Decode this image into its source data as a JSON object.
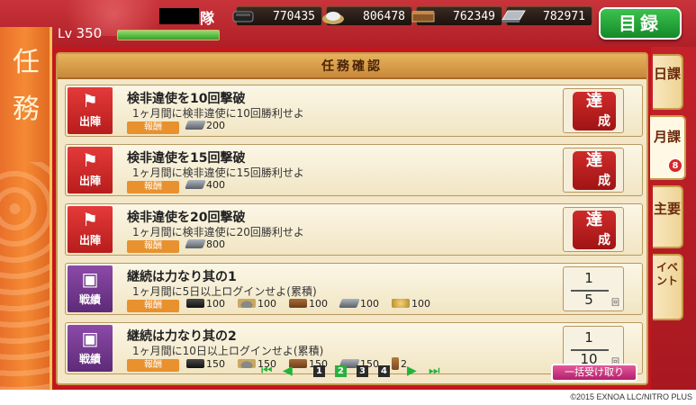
{
  "header": {
    "level_label": "Lv",
    "level_value": "350",
    "hp_fraction": 1.0,
    "unit_suffix": "隊",
    "resources": [
      {
        "icon": "charcoal-icon",
        "value": "770435"
      },
      {
        "icon": "coolant-icon",
        "value": "806478"
      },
      {
        "icon": "whetstone-icon",
        "value": "762349"
      },
      {
        "icon": "steel-icon",
        "value": "782971"
      }
    ],
    "catalog_button": "目録"
  },
  "side_title": "任務",
  "panel_title": "任務確認",
  "reward_label": "報酬",
  "quests": [
    {
      "badge": "出陣",
      "badge_type": "sortie",
      "title": "検非違使を10回撃破",
      "desc": "1ヶ月間に検非違使に10回勝利せよ",
      "rewards": [
        {
          "icon": "steel",
          "value": "200"
        }
      ],
      "status": "done",
      "seal_top": "達",
      "seal_bottom": "成"
    },
    {
      "badge": "出陣",
      "badge_type": "sortie",
      "title": "検非違使を15回撃破",
      "desc": "1ヶ月間に検非違使に15回勝利せよ",
      "rewards": [
        {
          "icon": "steel",
          "value": "400"
        }
      ],
      "status": "done",
      "seal_top": "達",
      "seal_bottom": "成"
    },
    {
      "badge": "出陣",
      "badge_type": "sortie",
      "title": "検非違使を20回撃破",
      "desc": "1ヶ月間に検非違使に20回勝利せよ",
      "rewards": [
        {
          "icon": "steel",
          "value": "800"
        }
      ],
      "status": "done",
      "seal_top": "達",
      "seal_bottom": "成"
    },
    {
      "badge": "戦績",
      "badge_type": "record",
      "title": "継続は力なり其の1",
      "desc": "1ヶ月間に5日以上ログインせよ(累積)",
      "rewards": [
        {
          "icon": "char",
          "value": "100"
        },
        {
          "icon": "coolant",
          "value": "100"
        },
        {
          "icon": "whet",
          "value": "100"
        },
        {
          "icon": "steel",
          "value": "100"
        },
        {
          "icon": "koban",
          "value": "100"
        }
      ],
      "status": "progress",
      "progress_current": "1",
      "progress_target": "5",
      "progress_unit": "回"
    },
    {
      "badge": "戦績",
      "badge_type": "record",
      "title": "継続は力なり其の2",
      "desc": "1ヶ月間に10日以上ログインせよ(累積)",
      "rewards": [
        {
          "icon": "char",
          "value": "150"
        },
        {
          "icon": "coolant",
          "value": "150"
        },
        {
          "icon": "whet",
          "value": "150"
        },
        {
          "icon": "steel",
          "value": "150"
        },
        {
          "icon": "plank",
          "value": "2"
        }
      ],
      "status": "progress",
      "progress_current": "1",
      "progress_target": "10",
      "progress_unit": "回"
    }
  ],
  "pager": {
    "pages": [
      "1",
      "2",
      "3",
      "4"
    ],
    "current": "2"
  },
  "bulk_receive": "一括受け取り",
  "tabs": [
    {
      "label": "日課",
      "active": false
    },
    {
      "label": "月課",
      "active": true,
      "count": "8"
    },
    {
      "label": "主要",
      "active": false
    },
    {
      "label": "イベント",
      "active": false
    }
  ],
  "copyright": "©2015 EXNOA LLC/NITRO PLUS",
  "colors": {
    "frame_red": "#c3161e",
    "paper": "#f3e7c8",
    "accent_green": "#28b03c",
    "seal_red": "#cf2a2a"
  }
}
